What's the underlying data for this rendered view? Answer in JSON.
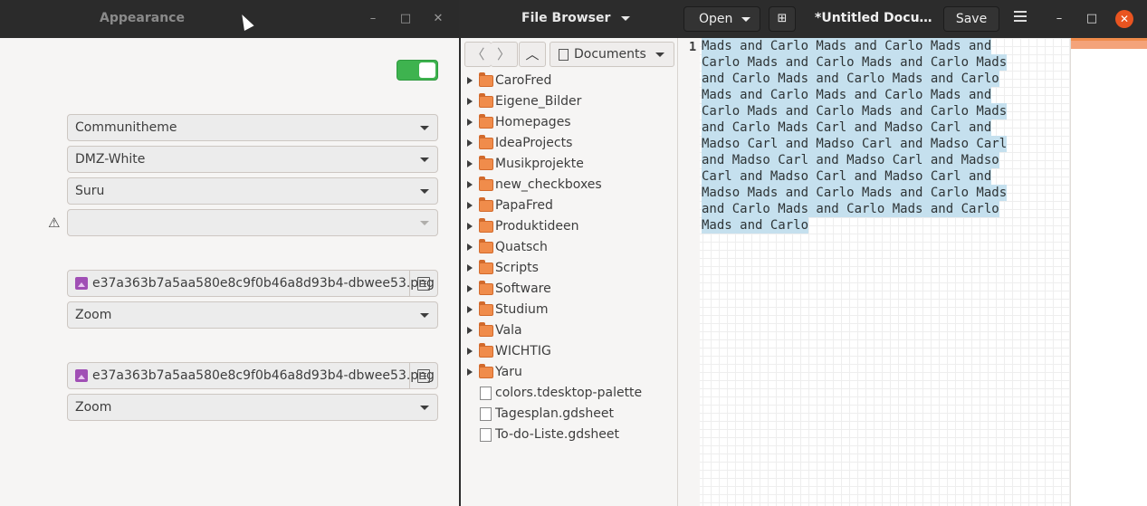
{
  "appearance": {
    "title": "Appearance",
    "combos": [
      {
        "value": "Communitheme"
      },
      {
        "value": "DMZ-White"
      },
      {
        "value": "Suru"
      },
      {
        "value": ""
      }
    ],
    "wallpaper_1": {
      "file": "e37a363b7a5aa580e8c9f0b46a8d93b4-dbwee53.png",
      "mode": "Zoom"
    },
    "wallpaper_2": {
      "file": "e37a363b7a5aa580e8c9f0b46a8d93b4-dbwee53.png",
      "mode": "Zoom"
    },
    "icons": {
      "min": "–",
      "max": "□",
      "close": "✕",
      "warning": "⚠"
    }
  },
  "editor": {
    "header": {
      "file_browser": "File Browser",
      "open": "Open",
      "new_tab_icon": "⊞",
      "doc_title": "*Untitled Docu…",
      "save": "Save"
    },
    "sidepanel": {
      "location": "Documents",
      "icons": {
        "back": "〈",
        "forward": "〉",
        "up": "︿"
      },
      "folders": [
        "CaroFred",
        "Eigene_Bilder",
        "Homepages",
        "IdeaProjects",
        "Musikprojekte",
        "new_checkboxes",
        "PapaFred",
        "Produktideen",
        "Quatsch",
        "Scripts",
        "Software",
        "Studium",
        "Vala",
        "WICHTIG",
        "Yaru"
      ],
      "files": [
        "colors.tdesktop-palette",
        "Tagesplan.gdsheet",
        "To-do-Liste.gdsheet"
      ]
    },
    "line_number": "1",
    "text_lines": [
      "Mads and Carlo Mads and Carlo Mads and",
      "Carlo Mads and Carlo Mads and Carlo Mads",
      "and Carlo Mads and Carlo Mads and Carlo",
      "Mads and Carlo Mads and Carlo Mads and",
      "Carlo Mads and Carlo Mads and Carlo Mads",
      "and Carlo Mads Carl and Madso Carl and",
      "Madso Carl and Madso Carl and Madso Carl",
      "and Madso Carl and Madso Carl and Madso",
      "Carl and Madso Carl and Madso Carl and",
      "Madso Mads and Carlo Mads and Carlo Mads",
      "and Carlo Mads and Carlo Mads and Carlo",
      "Mads and Carlo"
    ]
  }
}
